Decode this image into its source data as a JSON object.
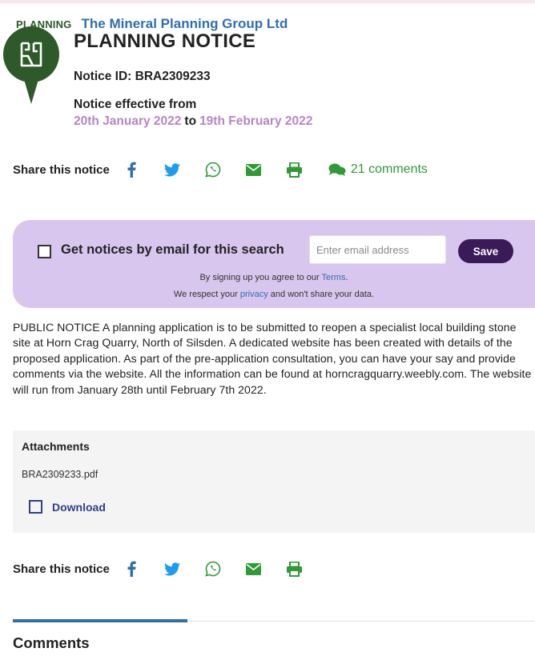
{
  "header": {
    "category": "PLANNING",
    "company": "The Mineral Planning Group Ltd",
    "title": "PLANNING NOTICE",
    "notice_id": "Notice ID: BRA2309233",
    "effective_label": "Notice effective from",
    "effective_from": "20th January 2022",
    "effective_to_word": "to",
    "effective_to": "19th February 2022"
  },
  "share": {
    "label": "Share this notice",
    "comments_label": "21 comments",
    "icons": [
      "facebook-icon",
      "twitter-icon",
      "whatsapp-icon",
      "email-icon",
      "print-icon"
    ]
  },
  "signup": {
    "label": "Get notices by email for this search",
    "placeholder": "Enter email address",
    "save_label": "Save",
    "terms_prefix": "By signing up you agree to our",
    "terms_link": "Terms",
    "terms_suffix": ".",
    "privacy_prefix": "We respect your",
    "privacy_link": "privacy",
    "privacy_suffix": "and won't share your data."
  },
  "notice": {
    "body": "PUBLIC NOTICE A planning application is to be submitted to reopen a specialist local building stone site at Horn Crag Quarry, North of Silsden. A dedicated website has been created with details of the proposed application. As part of the pre-application consultation, you can have your say and provide comments via the website. All the information can be found at horncragquarry.weebly.com. The website will run from January 28th until February 7th 2022."
  },
  "attachments": {
    "title": "Attachments",
    "file_name": "BRA2309233.pdf",
    "download_label": "Download"
  },
  "comments": {
    "heading": "Comments"
  },
  "colors": {
    "brand_green": "#2e5a2a",
    "link_blue": "#2f6fb0",
    "date_purple": "#b685c8",
    "signup_bg": "#d9c6ee",
    "save_button": "#3a1a57",
    "share_icon_blue": "#1d9bf0",
    "share_icon_green": "#2f9a37"
  }
}
